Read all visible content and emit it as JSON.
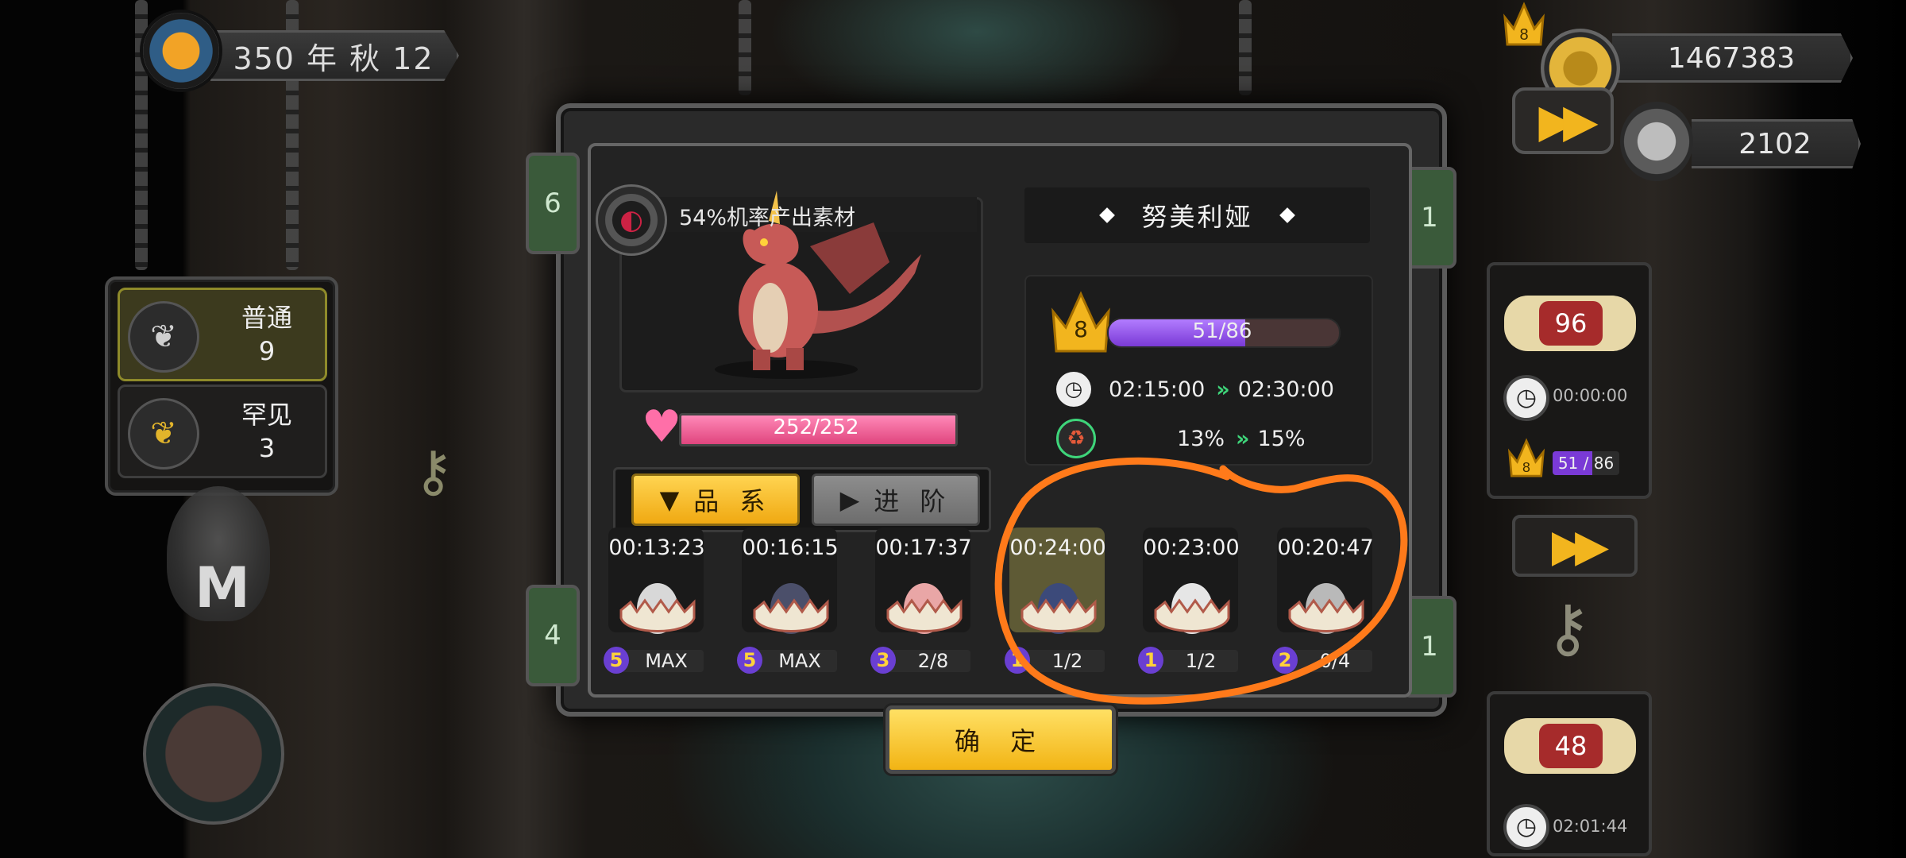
{
  "header": {
    "date_text": "350 年 秋 12"
  },
  "resources": {
    "gold": "1467383",
    "cans": "2102",
    "top_level": "8"
  },
  "rarity_list": [
    {
      "name": "普通",
      "count": "9",
      "icon": "silver-leaf-icon",
      "active": true
    },
    {
      "name": "罕见",
      "count": "3",
      "icon": "gold-leaf-icon",
      "active": false
    }
  ],
  "side_tabs": {
    "left_top": "6",
    "left_bottom": "4",
    "right_top": "1",
    "right_bottom": "1"
  },
  "creature": {
    "drop_rate": "54%机率产出素材",
    "name": "努美利娅",
    "level": "8",
    "exp_text": "51/86",
    "exp_fraction": 0.593,
    "time_current": "02:15:00",
    "time_next": "02:30:00",
    "rate_current": "13%",
    "rate_next": "15%",
    "hp_text": "252/252",
    "hp_fraction": 1.0
  },
  "tabs": {
    "pinxi": "品 系",
    "jinjie": "进 阶"
  },
  "slots": [
    {
      "time": "00:13:23",
      "level": "5",
      "progress": "MAX",
      "selected": false
    },
    {
      "time": "00:16:15",
      "level": "5",
      "progress": "MAX",
      "selected": false
    },
    {
      "time": "00:17:37",
      "level": "3",
      "progress": "2/8",
      "selected": false
    },
    {
      "time": "00:24:00",
      "level": "1",
      "progress": "1/2",
      "selected": true
    },
    {
      "time": "00:23:00",
      "level": "1",
      "progress": "1/2",
      "selected": false
    },
    {
      "time": "00:20:47",
      "level": "2",
      "progress": "0/4",
      "selected": false
    }
  ],
  "confirm_label": "确 定",
  "right_column": {
    "card1_value": "96",
    "card1_time": "00:00:00",
    "crown_level": "8",
    "crown_exp": "51 / 86",
    "crown_exp_fraction": 0.593,
    "card2_value": "48",
    "card2_time": "02:01:44"
  },
  "colors": {
    "accent_gold": "#f2b51e",
    "exp_purple": "#7a3ad6",
    "hp_pink": "#e0457e",
    "annotation_orange": "#ff7a1a"
  }
}
